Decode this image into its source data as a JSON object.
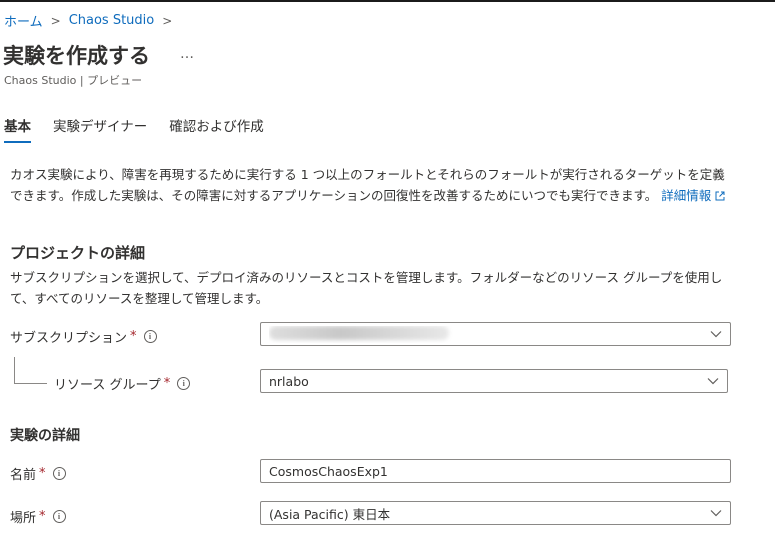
{
  "breadcrumb": {
    "home": "ホーム",
    "chaos_studio": "Chaos Studio"
  },
  "page": {
    "title": "実験を作成する",
    "more": "…",
    "subtitle": "Chaos Studio | プレビュー"
  },
  "tabs": [
    {
      "label": "基本",
      "active": true
    },
    {
      "label": "実験デザイナー",
      "active": false
    },
    {
      "label": "確認および作成",
      "active": false
    }
  ],
  "description": {
    "text": "カオス実験により、障害を再現するために実行する 1 つ以上のフォールトとそれらのフォールトが実行されるターゲットを定義できます。作成した実験は、その障害に対するアプリケーションの回復性を改善するためにいつでも実行できます。",
    "learn_more": "詳細情報"
  },
  "project_details": {
    "title": "プロジェクトの詳細",
    "description": "サブスクリプションを選択して、デプロイ済みのリソースとコストを管理します。フォルダーなどのリソース グループを使用して、すべてのリソースを整理して管理します。",
    "subscription": {
      "label": "サブスクリプション",
      "required": "*"
    },
    "resource_group": {
      "label": "リソース グループ",
      "required": "*",
      "value": "nrlabo"
    }
  },
  "experiment_details": {
    "title": "実験の詳細",
    "name": {
      "label": "名前",
      "required": "*",
      "value": "CosmosChaosExp1"
    },
    "location": {
      "label": "場所",
      "required": "*",
      "value": "(Asia Pacific) 東日本"
    }
  },
  "colors": {
    "accent": "#0f6cbd",
    "required": "#a4262c",
    "border": "#8a8886"
  }
}
